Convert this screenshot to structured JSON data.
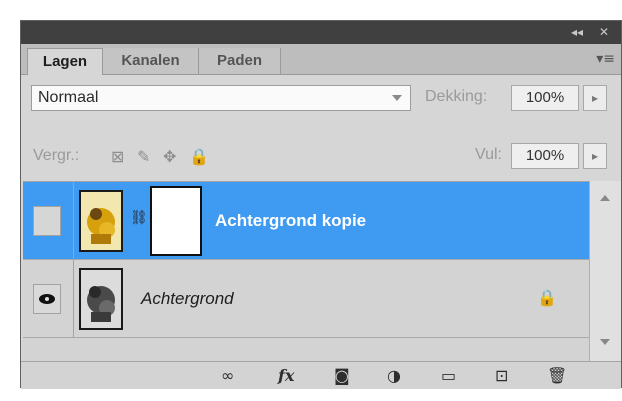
{
  "titlebar": {
    "collapse_icon": "◂◂",
    "close_icon": "✕"
  },
  "tabs": [
    {
      "label": "Lagen",
      "active": true
    },
    {
      "label": "Kanalen",
      "active": false
    },
    {
      "label": "Paden",
      "active": false
    }
  ],
  "panel_menu_icon": "▾≡",
  "blend_mode": {
    "value": "Normaal"
  },
  "opacity": {
    "label": "Dekking:",
    "value": "100%"
  },
  "lock": {
    "label": "Vergr.:",
    "icons": [
      "lock-transparent-icon",
      "lock-image-icon",
      "lock-position-icon",
      "lock-all-icon"
    ]
  },
  "fill": {
    "label": "Vul:",
    "value": "100%"
  },
  "layers": [
    {
      "name": "Achtergrond kopie",
      "selected": true,
      "visible": false,
      "has_mask": true
    },
    {
      "name": "Achtergrond",
      "selected": false,
      "visible": true,
      "locked": true
    }
  ],
  "colors": {
    "selection": "#3f9af2",
    "panel_bg": "#d6d6d6",
    "titlebar": "#404040"
  },
  "bottom_icons": [
    "link-layers-icon",
    "fx-icon",
    "add-mask-icon",
    "adjustment-layer-icon",
    "new-group-icon",
    "new-layer-icon",
    "delete-layer-icon"
  ],
  "bottom_glyphs": {
    "link": "∞",
    "fx": "fx",
    "mask": "◙",
    "adjust": "◑",
    "group": "▭",
    "new": "⊡",
    "delete": "🗑"
  }
}
